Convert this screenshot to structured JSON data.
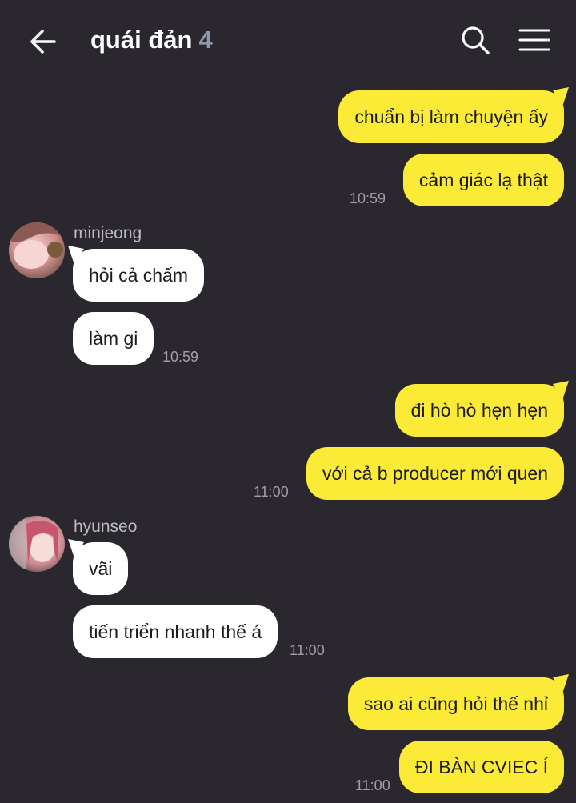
{
  "header": {
    "title": "quái đản",
    "count": "4",
    "back_icon": "arrow-left-icon",
    "search_icon": "search-icon",
    "menu_icon": "hamburger-menu-icon"
  },
  "colors": {
    "background": "#2a282e",
    "my_bubble": "#fbea36",
    "their_bubble": "#ffffff",
    "timestamp": "#a29ea6",
    "count": "#8e9aa6"
  },
  "messages": [
    {
      "from": "me",
      "text": "chuẩn bị làm chuyện ấy"
    },
    {
      "from": "me",
      "text": "cảm giác lạ thật",
      "time": "10:59"
    },
    {
      "from": "minjeong",
      "sender": "minjeong",
      "text": "hỏi cả chấm"
    },
    {
      "from": "minjeong",
      "text": "làm gi",
      "time": "10:59"
    },
    {
      "from": "me",
      "text": "đi hò hò hẹn hẹn"
    },
    {
      "from": "me",
      "text": "với cả b producer mới quen",
      "time": "11:00"
    },
    {
      "from": "hyunseo",
      "sender": "hyunseo",
      "text": "vãi"
    },
    {
      "from": "hyunseo",
      "text": "tiến triển nhanh thế á",
      "time": "11:00"
    },
    {
      "from": "me",
      "text": "sao ai cũng hỏi thế nhỉ"
    },
    {
      "from": "me",
      "text": "ĐI BÀN CVIEC Í",
      "time": "11:00"
    }
  ]
}
